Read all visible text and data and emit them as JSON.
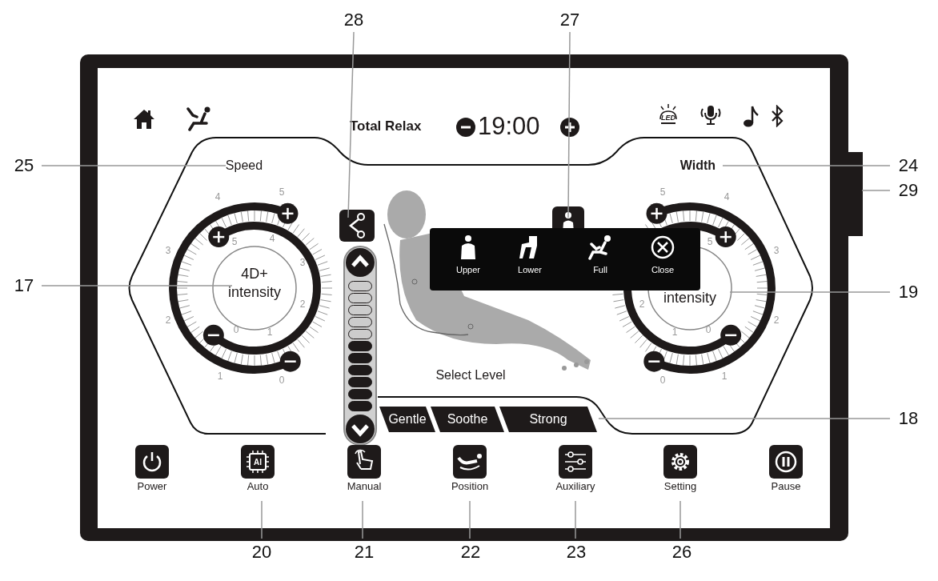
{
  "callouts": [
    {
      "number": "28"
    },
    {
      "number": "27"
    },
    {
      "number": "25"
    },
    {
      "number": "24"
    },
    {
      "number": "29"
    },
    {
      "number": "17"
    },
    {
      "number": "19"
    },
    {
      "number": "18"
    },
    {
      "number": "20"
    },
    {
      "number": "21"
    },
    {
      "number": "22"
    },
    {
      "number": "23"
    },
    {
      "number": "26"
    }
  ],
  "header": {
    "title": "Total Relax",
    "timer": "19:00",
    "status_icons": [
      {
        "kind": "led",
        "text": "LED"
      },
      {
        "kind": "mic"
      },
      {
        "kind": "note"
      },
      {
        "kind": "bluetooth"
      }
    ]
  },
  "left_dial": {
    "label": "Speed",
    "center_text": [
      "4D+",
      "intensity"
    ],
    "outer_scale": [
      "5",
      "4",
      "3",
      "2",
      "1",
      "0"
    ],
    "inner_scale": [
      "5",
      "4",
      "3",
      "2",
      "1",
      "0"
    ]
  },
  "right_dial": {
    "label": "Width",
    "center_text": [
      "intensity"
    ],
    "outer_scale": [
      "5",
      "4",
      "3",
      "2",
      "1",
      "0"
    ],
    "inner_scale": [
      "5",
      "2",
      "1",
      "0"
    ]
  },
  "level_slider": {
    "level": 0.545
  },
  "area_popup": {
    "items": [
      {
        "kind": "upper",
        "label": "Upper"
      },
      {
        "kind": "lower",
        "label": "Lower"
      },
      {
        "kind": "full",
        "label": "Full"
      },
      {
        "kind": "close",
        "label": "Close"
      }
    ]
  },
  "select_level": {
    "title": "Select Level",
    "options": [
      "Gentle",
      "Soothe",
      "Strong"
    ]
  },
  "bottom_buttons": [
    {
      "kind": "power",
      "label": "Power"
    },
    {
      "kind": "auto",
      "label": "Auto",
      "icon_text": "AI"
    },
    {
      "kind": "manual",
      "label": "Manual"
    },
    {
      "kind": "position",
      "label": "Position"
    },
    {
      "kind": "auxiliary",
      "label": "Auxiliary"
    },
    {
      "kind": "setting",
      "label": "Setting"
    },
    {
      "kind": "pause",
      "label": "Pause"
    }
  ]
}
